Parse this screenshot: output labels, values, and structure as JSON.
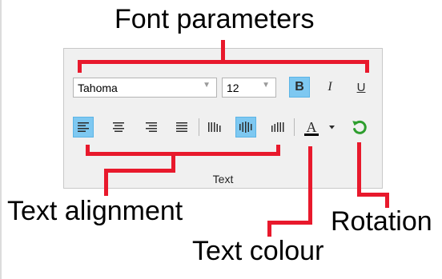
{
  "callouts": {
    "font_parameters": "Font parameters",
    "text_alignment": "Text alignment",
    "text_colour": "Text colour",
    "rotation": "Rotation"
  },
  "toolbar": {
    "group_label": "Text",
    "font_family": "Tahoma",
    "font_size": "12",
    "bold_label": "B",
    "italic_label": "I",
    "underline_label": "U",
    "colour_label": "A",
    "colour_value": "#000000",
    "active_color": "#7ec8f1",
    "states": {
      "bold": true,
      "align": "left",
      "distribute": "center"
    },
    "icons": [
      "align-left-icon",
      "align-center-icon",
      "align-right-icon",
      "align-justify-icon",
      "distribute-left-icon",
      "distribute-center-icon",
      "distribute-right-icon",
      "text-colour-icon",
      "dropdown-arrow-icon",
      "rotate-icon"
    ]
  },
  "colors": {
    "callout_lines": "#e8192c",
    "rotation_icon": "#2e9e2e"
  }
}
